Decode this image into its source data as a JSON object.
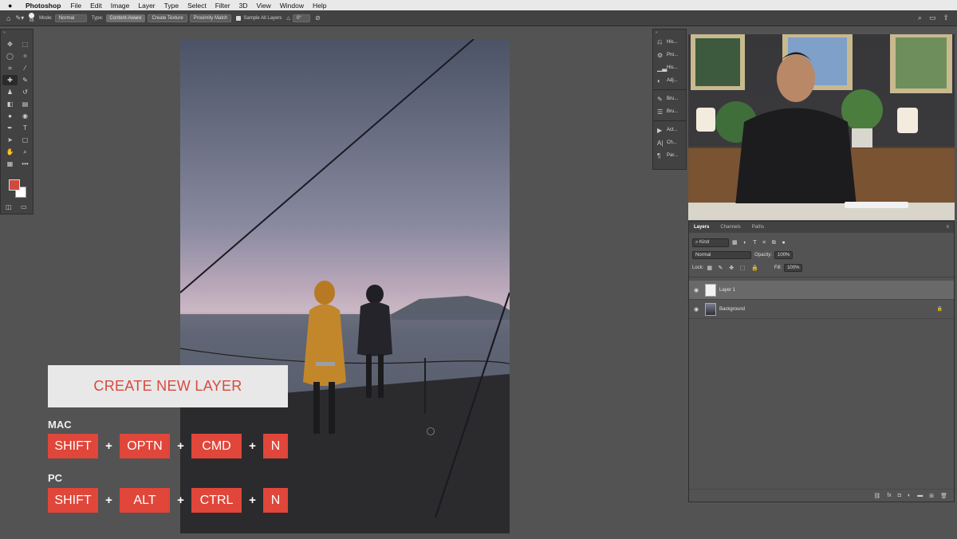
{
  "menubar": {
    "app_name": "Photoshop",
    "items": [
      "File",
      "Edit",
      "Image",
      "Layer",
      "Type",
      "Select",
      "Filter",
      "3D",
      "View",
      "Window",
      "Help"
    ]
  },
  "options_bar": {
    "brush_size": "88",
    "mode_label": "Mode:",
    "mode_value": "Normal",
    "type_label": "Type:",
    "type_buttons": [
      "Content-Aware",
      "Create Texture",
      "Proximity Match"
    ],
    "sample_all_layers": "Sample All Layers",
    "angle_value": "0°"
  },
  "icon_panel": {
    "group1": [
      "His...",
      "Pro...",
      "His...",
      "Adj..."
    ],
    "group2": [
      "Bru...",
      "Bru..."
    ],
    "group3": [
      "Act...",
      "Ch...",
      "Par..."
    ]
  },
  "layers_panel": {
    "tabs": [
      "Layers",
      "Channels",
      "Paths"
    ],
    "filter_value": "Kind",
    "blend_mode": "Normal",
    "opacity_label": "Opacity:",
    "opacity_value": "100%",
    "lock_label": "Lock:",
    "fill_label": "Fill:",
    "fill_value": "100%",
    "layers": [
      {
        "name": "Layer 1"
      },
      {
        "name": "Background"
      }
    ]
  },
  "overlay": {
    "title": "CREATE NEW LAYER",
    "mac": {
      "label": "MAC",
      "keys": [
        "SHIFT",
        "OPTN",
        "CMD",
        "N"
      ]
    },
    "pc": {
      "label": "PC",
      "keys": [
        "SHIFT",
        "ALT",
        "CTRL",
        "N"
      ]
    },
    "plus": "+"
  },
  "colors": {
    "foreground": "#d04a3d",
    "background": "#ffffff",
    "accent": "#e0463a"
  }
}
